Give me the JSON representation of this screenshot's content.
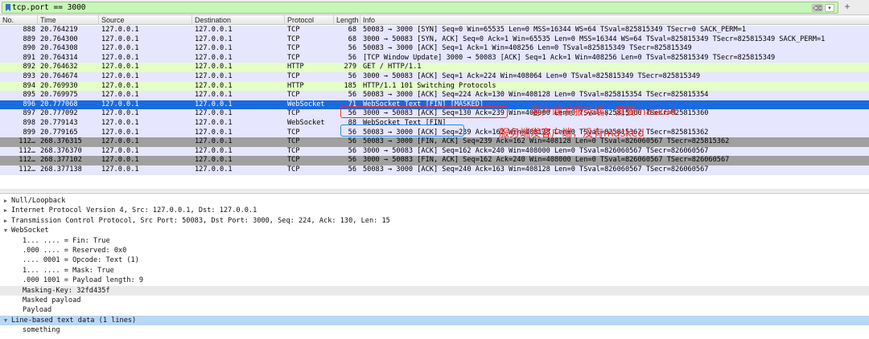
{
  "filter": {
    "value": "tcp.port == 3000",
    "clear_label": "⌫",
    "arrow_label": "▾",
    "plus_label": "+"
  },
  "columns": [
    "No.",
    "Time",
    "Source",
    "Destination",
    "Protocol",
    "Length",
    "Info"
  ],
  "colors": {
    "tcp": "#e7e6ff",
    "http": "#e4ffc7",
    "fin": "#a0a0a0",
    "selected": "#1a6ae0",
    "annotation_red": "#e8312b",
    "annotation_blue": "#1e8fe0"
  },
  "packets": [
    {
      "no": "888",
      "time": "20.764219",
      "src": "127.0.0.1",
      "dst": "127.0.0.1",
      "proto": "TCP",
      "len": "68",
      "info": "50083 → 3000 [SYN] Seq=0 Win=65535 Len=0 MSS=16344 WS=64 TSval=825815349 TSecr=0 SACK_PERM=1",
      "kind": "tcp"
    },
    {
      "no": "889",
      "time": "20.764300",
      "src": "127.0.0.1",
      "dst": "127.0.0.1",
      "proto": "TCP",
      "len": "68",
      "info": "3000 → 50083 [SYN, ACK] Seq=0 Ack=1 Win=65535 Len=0 MSS=16344 WS=64 TSval=825815349 TSecr=825815349 SACK_PERM=1",
      "kind": "tcp"
    },
    {
      "no": "890",
      "time": "20.764308",
      "src": "127.0.0.1",
      "dst": "127.0.0.1",
      "proto": "TCP",
      "len": "56",
      "info": "50083 → 3000 [ACK] Seq=1 Ack=1 Win=408256 Len=0 TSval=825815349 TSecr=825815349",
      "kind": "tcp"
    },
    {
      "no": "891",
      "time": "20.764314",
      "src": "127.0.0.1",
      "dst": "127.0.0.1",
      "proto": "TCP",
      "len": "56",
      "info": "[TCP Window Update] 3000 → 50083 [ACK] Seq=1 Ack=1 Win=408256 Len=0 TSval=825815349 TSecr=825815349",
      "kind": "tcp"
    },
    {
      "no": "892",
      "time": "20.764632",
      "src": "127.0.0.1",
      "dst": "127.0.0.1",
      "proto": "HTTP",
      "len": "279",
      "info": "GET / HTTP/1.1",
      "kind": "http"
    },
    {
      "no": "893",
      "time": "20.764674",
      "src": "127.0.0.1",
      "dst": "127.0.0.1",
      "proto": "TCP",
      "len": "56",
      "info": "3000 → 50083 [ACK] Seq=1 Ack=224 Win=408064 Len=0 TSval=825815349 TSecr=825815349",
      "kind": "tcp"
    },
    {
      "no": "894",
      "time": "20.769930",
      "src": "127.0.0.1",
      "dst": "127.0.0.1",
      "proto": "HTTP",
      "len": "185",
      "info": "HTTP/1.1 101 Switching Protocols",
      "kind": "http"
    },
    {
      "no": "895",
      "time": "20.769975",
      "src": "127.0.0.1",
      "dst": "127.0.0.1",
      "proto": "TCP",
      "len": "56",
      "info": "50083 → 3000 [ACK] Seq=224 Ack=130 Win=408128 Len=0 TSval=825815354 TSecr=825815354",
      "kind": "tcp"
    },
    {
      "no": "896",
      "time": "20.777068",
      "src": "127.0.0.1",
      "dst": "127.0.0.1",
      "proto": "WebSocket",
      "len": "71",
      "info": "WebSocket Text [FIN] [MASKED]",
      "kind": "selected"
    },
    {
      "no": "897",
      "time": "20.777092",
      "src": "127.0.0.1",
      "dst": "127.0.0.1",
      "proto": "TCP",
      "len": "56",
      "info": "3000 → 50083 [ACK] Seq=130 Ack=239 Win=408000 Len=0 TSval=825815360 TSecr=825815360",
      "kind": "tcp"
    },
    {
      "no": "898",
      "time": "20.779143",
      "src": "127.0.0.1",
      "dst": "127.0.0.1",
      "proto": "WebSocket",
      "len": "88",
      "info": "WebSocket Text [FIN]",
      "kind": "tcp"
    },
    {
      "no": "899",
      "time": "20.779165",
      "src": "127.0.0.1",
      "dst": "127.0.0.1",
      "proto": "TCP",
      "len": "56",
      "info": "50083 → 3000 [ACK] Seq=239 Ack=162 Win=408128 Len=0 TSval=825815362 TSecr=825815362",
      "kind": "tcp"
    },
    {
      "no": "112…",
      "time": "268.376315",
      "src": "127.0.0.1",
      "dst": "127.0.0.1",
      "proto": "TCP",
      "len": "56",
      "info": "50083 → 3000 [FIN, ACK] Seq=239 Ack=162 Win=408128 Len=0 TSval=826060567 TSecr=825815362",
      "kind": "fin"
    },
    {
      "no": "112…",
      "time": "268.376370",
      "src": "127.0.0.1",
      "dst": "127.0.0.1",
      "proto": "TCP",
      "len": "56",
      "info": "3000 → 50083 [ACK] Seq=162 Ack=240 Win=408000 Len=0 TSval=826060567 TSecr=826060567",
      "kind": "tcp"
    },
    {
      "no": "112…",
      "time": "268.377102",
      "src": "127.0.0.1",
      "dst": "127.0.0.1",
      "proto": "TCP",
      "len": "56",
      "info": "3000 → 50083 [FIN, ACK] Seq=162 Ack=240 Win=408000 Len=0 TSval=826060567 TSecr=826060567",
      "kind": "fin"
    },
    {
      "no": "112…",
      "time": "268.377138",
      "src": "127.0.0.1",
      "dst": "127.0.0.1",
      "proto": "TCP",
      "len": "56",
      "info": "50083 → 3000 [ACK] Seq=240 Ack=163 Win=408128 Len=0 TSval=826060567 TSecr=826060567",
      "kind": "tcp"
    }
  ],
  "annotations": {
    "masked_note": "客户端发服务端，需要masked",
    "unmasked_note": "服务端发客户端，没有masked"
  },
  "details": [
    {
      "text": "Null/Loopback",
      "indent": 0,
      "tri": "▶",
      "hl": false
    },
    {
      "text": "Internet Protocol Version 4, Src: 127.0.0.1, Dst: 127.0.0.1",
      "indent": 0,
      "tri": "▶",
      "hl": false
    },
    {
      "text": "Transmission Control Protocol, Src Port: 50083, Dst Port: 3000, Seq: 224, Ack: 130, Len: 15",
      "indent": 0,
      "tri": "▶",
      "hl": false
    },
    {
      "text": "WebSocket",
      "indent": 0,
      "tri": "▼",
      "hl": false
    },
    {
      "text": "1... .... = Fin: True",
      "indent": 1,
      "tri": "",
      "hl": false
    },
    {
      "text": ".000 .... = Reserved: 0x0",
      "indent": 1,
      "tri": "",
      "hl": false
    },
    {
      "text": ".... 0001 = Opcode: Text (1)",
      "indent": 1,
      "tri": "",
      "hl": false
    },
    {
      "text": "1... .... = Mask: True",
      "indent": 1,
      "tri": "",
      "hl": false
    },
    {
      "text": ".000 1001 = Payload length: 9",
      "indent": 1,
      "tri": "",
      "hl": false
    },
    {
      "text": "Masking-Key: 32fd435f",
      "indent": 1,
      "tri": "",
      "hl": "soft"
    },
    {
      "text": "Masked payload",
      "indent": 1,
      "tri": "",
      "hl": false
    },
    {
      "text": "Payload",
      "indent": 1,
      "tri": "",
      "hl": false
    },
    {
      "text": "Line-based text data (1 lines)",
      "indent": 0,
      "tri": "▼",
      "hl": "blue"
    },
    {
      "text": "something",
      "indent": 1,
      "tri": "",
      "hl": false
    }
  ]
}
